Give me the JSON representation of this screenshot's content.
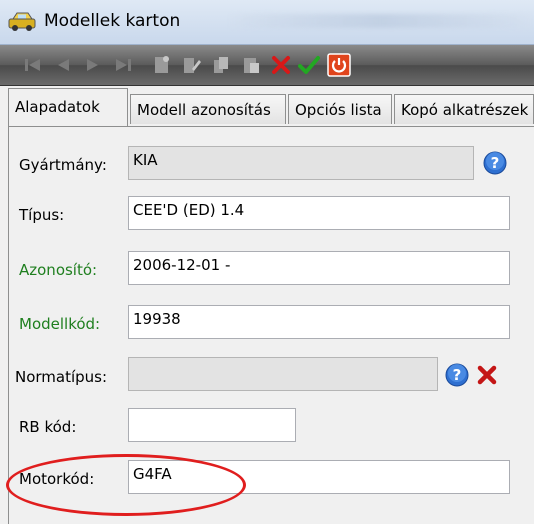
{
  "window": {
    "title": "Modellek karton"
  },
  "toolbar": {
    "buttons": [
      "first-icon",
      "prev-icon",
      "next-icon",
      "last-icon",
      "new-icon",
      "edit-icon",
      "copy-icon",
      "paste-icon",
      "delete-icon",
      "confirm-icon",
      "close-icon"
    ]
  },
  "tabs": [
    {
      "label": "Alapadatok",
      "active": true
    },
    {
      "label": "Modell azonosítás",
      "active": false
    },
    {
      "label": "Opciós lista",
      "active": false
    },
    {
      "label": "Kopó alkatrészek",
      "active": false
    }
  ],
  "form": {
    "gyartmany": {
      "label": "Gyártmány:",
      "value": "KIA"
    },
    "tipus": {
      "label": "Típus:",
      "value": "CEE'D (ED) 1.4"
    },
    "azonosito": {
      "label": "Azonosító:",
      "value": "2006-12-01 -"
    },
    "modellkod": {
      "label": "Modellkód:",
      "value": "19938"
    },
    "normatipus": {
      "label": "Normatípus:",
      "value": ""
    },
    "rbkod": {
      "label": "RB kód:",
      "value": ""
    },
    "motorkod": {
      "label": "Motorkód:",
      "value": "G4FA"
    }
  },
  "colors": {
    "green_label": "#1f7f1f",
    "highlight_ellipse": "#e01e1e"
  }
}
